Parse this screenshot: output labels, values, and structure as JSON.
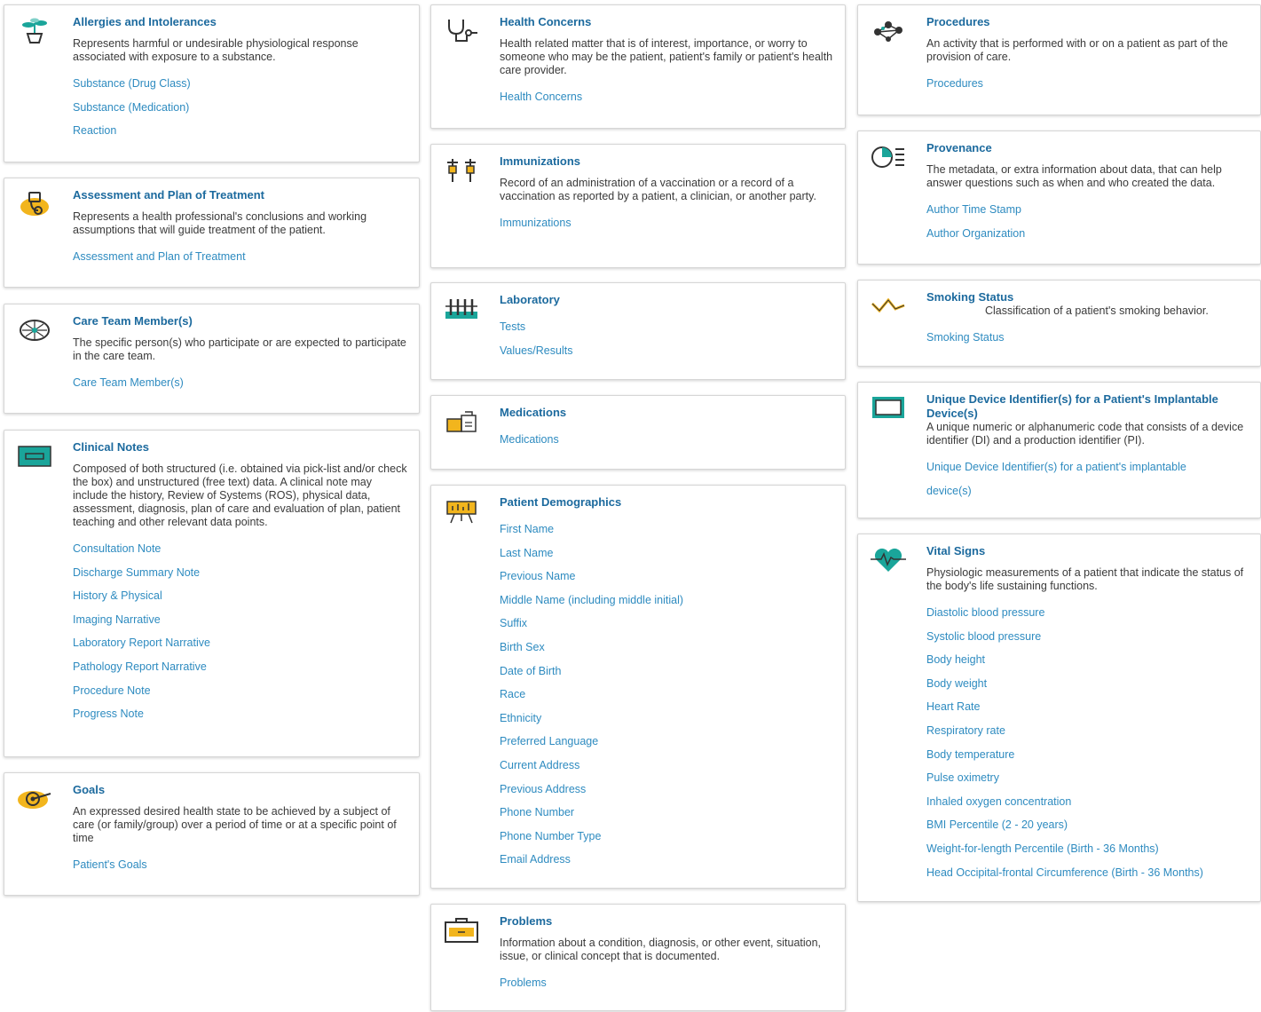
{
  "colors": {
    "title": "#1c6a9e",
    "link": "#2e8bc0",
    "text": "#3a3a3a",
    "teal": "#1aa59a",
    "yellow": "#f2b51d"
  },
  "cards": {
    "allergies": {
      "icon": "plant-pot-icon",
      "title": "Allergies and Intolerances",
      "description": "Represents harmful or undesirable physiological response associated with exposure to a substance.",
      "links": [
        "Substance (Drug Class)",
        "Substance (Medication)",
        "Reaction"
      ]
    },
    "assessment": {
      "icon": "clipboard-stethoscope-icon",
      "title": "Assessment and Plan of Treatment",
      "description": "Represents a health professional's conclusions and working assumptions that will guide treatment of the patient.",
      "links": [
        "Assessment and Plan of Treatment"
      ]
    },
    "care_team": {
      "icon": "brain-network-icon",
      "title": "Care Team Member(s)",
      "description": "The specific person(s) who participate or are expected to participate in the care team.",
      "links": [
        "Care Team Member(s)"
      ]
    },
    "clinical_notes": {
      "icon": "id-card-icon",
      "title": "Clinical Notes",
      "description": "Composed of both structured (i.e. obtained via pick-list and/or check the box) and unstructured (free text) data. A clinical note may include the history, Review of Systems (ROS), physical data, assessment, diagnosis, plan of care and evaluation of plan, patient teaching and other relevant data points.",
      "links": [
        "Consultation Note",
        "Discharge Summary Note",
        "History & Physical",
        "Imaging Narrative",
        "Laboratory Report Narrative",
        "Pathology Report Narrative",
        "Procedure Note",
        "Progress Note"
      ]
    },
    "goals": {
      "icon": "target-icon",
      "title": "Goals",
      "description": "An expressed desired health state to be achieved by a subject of care (or family/group) over a period of time or at a specific point of time",
      "links": [
        "Patient's Goals"
      ]
    },
    "health_concerns": {
      "icon": "stethoscope-icon",
      "title": "Health Concerns",
      "description": "Health related matter that is of interest, importance, or worry to someone who may be the patient, patient's family or patient's health care provider.",
      "links": [
        "Health Concerns"
      ]
    },
    "immunizations": {
      "icon": "syringe-icon",
      "title": "Immunizations",
      "description": "Record of an administration of a vaccination or a record of a vaccination as reported by a patient, a clinician, or another party.",
      "links": [
        "Immunizations"
      ]
    },
    "laboratory": {
      "icon": "test-tubes-icon",
      "title": "Laboratory",
      "description": "",
      "links": [
        "Tests",
        "Values/Results"
      ]
    },
    "medications": {
      "icon": "pill-bottle-icon",
      "title": "Medications",
      "description": "",
      "links": [
        "Medications"
      ]
    },
    "demographics": {
      "icon": "easel-chart-icon",
      "title": "Patient Demographics",
      "description": "",
      "links": [
        "First Name",
        "Last Name",
        "Previous Name",
        "Middle Name (including middle initial)",
        "Suffix",
        "Birth Sex",
        "Date of Birth",
        "Race",
        "Ethnicity",
        "Preferred Language",
        "Current Address",
        "Previous Address",
        "Phone Number",
        "Phone Number Type",
        "Email Address"
      ]
    },
    "problems": {
      "icon": "briefcase-icon",
      "title": "Problems",
      "description": "Information about a condition, diagnosis, or other event, situation, issue, or clinical concept that is documented.",
      "links": [
        "Problems"
      ]
    },
    "procedures": {
      "icon": "network-nodes-icon",
      "title": "Procedures",
      "description": "An activity that is performed with or on a patient as part of the provision of care.",
      "links": [
        "Procedures"
      ]
    },
    "provenance": {
      "icon": "pie-chart-list-icon",
      "title": "Provenance",
      "description": "The metadata, or extra information about data, that can help answer questions such as when and who created the data.",
      "links": [
        "Author Time Stamp",
        "Author Organization"
      ]
    },
    "smoking": {
      "icon": "line-trend-icon",
      "title": "Smoking Status",
      "description": "Classification of a patient's smoking behavior.",
      "links": [
        "Smoking Status"
      ]
    },
    "udi": {
      "icon": "monitor-icon",
      "title": "Unique Device Identifier(s) for a Patient's Implantable Device(s)",
      "description": "A unique numeric or alphanumeric code that consists of a device identifier (DI) and a production identifier (PI).",
      "links": [
        "Unique Device Identifier(s) for a patient's implantable",
        "device(s)"
      ]
    },
    "vitals": {
      "icon": "heartbeat-icon",
      "title": "Vital Signs",
      "description": "Physiologic measurements of a patient that indicate the status of the body's life sustaining functions.",
      "links": [
        "Diastolic blood pressure",
        "Systolic blood pressure",
        "Body height",
        "Body weight",
        "Heart Rate",
        "Respiratory rate",
        "Body temperature",
        "Pulse oximetry",
        "Inhaled oxygen concentration",
        "BMI Percentile (2 - 20 years)",
        "Weight-for-length Percentile (Birth - 36 Months)",
        "Head Occipital-frontal Circumference (Birth - 36 Months)"
      ]
    }
  }
}
